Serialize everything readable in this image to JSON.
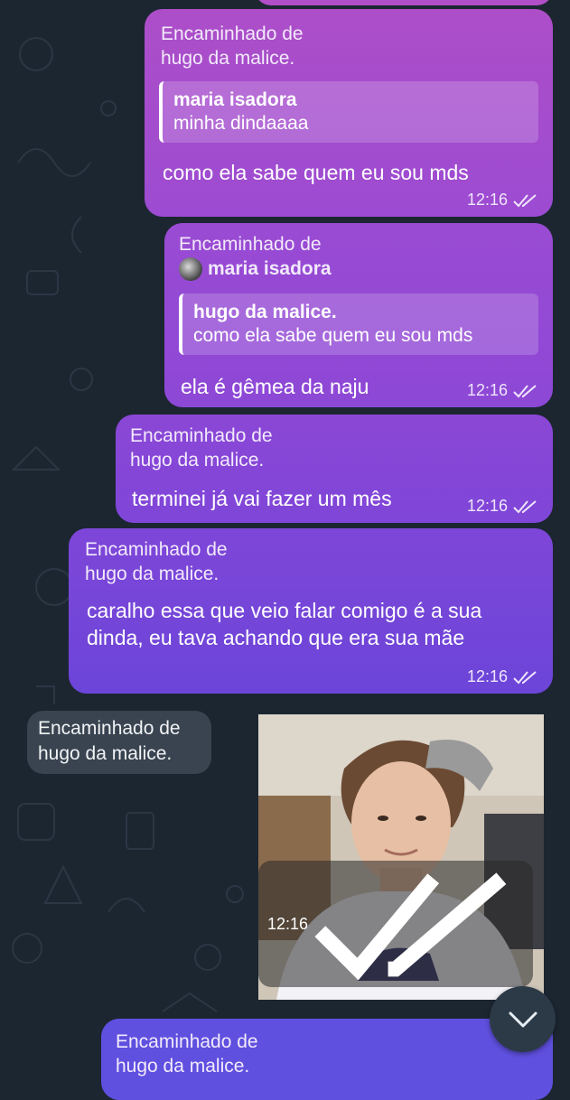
{
  "messages": [
    {
      "forwarded_label": "Encaminhado de",
      "forwarded_from": "hugo da malice.",
      "reply_name": "maria isadora",
      "reply_text": "minha dindaaaa",
      "text": "como ela sabe quem eu sou mds",
      "time": "12:16"
    },
    {
      "forwarded_label": "Encaminhado de",
      "forwarded_from": "maria isadora",
      "reply_name": "hugo da malice.",
      "reply_text": "como ela sabe quem eu sou mds",
      "text": "ela é gêmea da naju",
      "time": "12:16"
    },
    {
      "forwarded_label": "Encaminhado de",
      "forwarded_from": "hugo da malice.",
      "text": "terminei já vai fazer um mês",
      "time": "12:16"
    },
    {
      "forwarded_label": "Encaminhado de",
      "forwarded_from": "hugo da malice.",
      "text": "caralho essa que veio falar comigo é a sua dinda, eu tava achando que era sua mãe",
      "time": "12:16"
    },
    {
      "forwarded_label": "Encaminhado de",
      "forwarded_from": "hugo da malice.",
      "time": "12:16"
    },
    {
      "forwarded_label": "Encaminhado de",
      "forwarded_from": "hugo da malice."
    }
  ],
  "colors": {
    "background": "#1c2631",
    "bubble_top": "#ad4ec8",
    "bubble_bottom": "#5f50df",
    "incoming": "#3c4652"
  },
  "icons": {
    "read_receipt": "double-check-icon",
    "scroll_down": "chevron-down-icon"
  }
}
